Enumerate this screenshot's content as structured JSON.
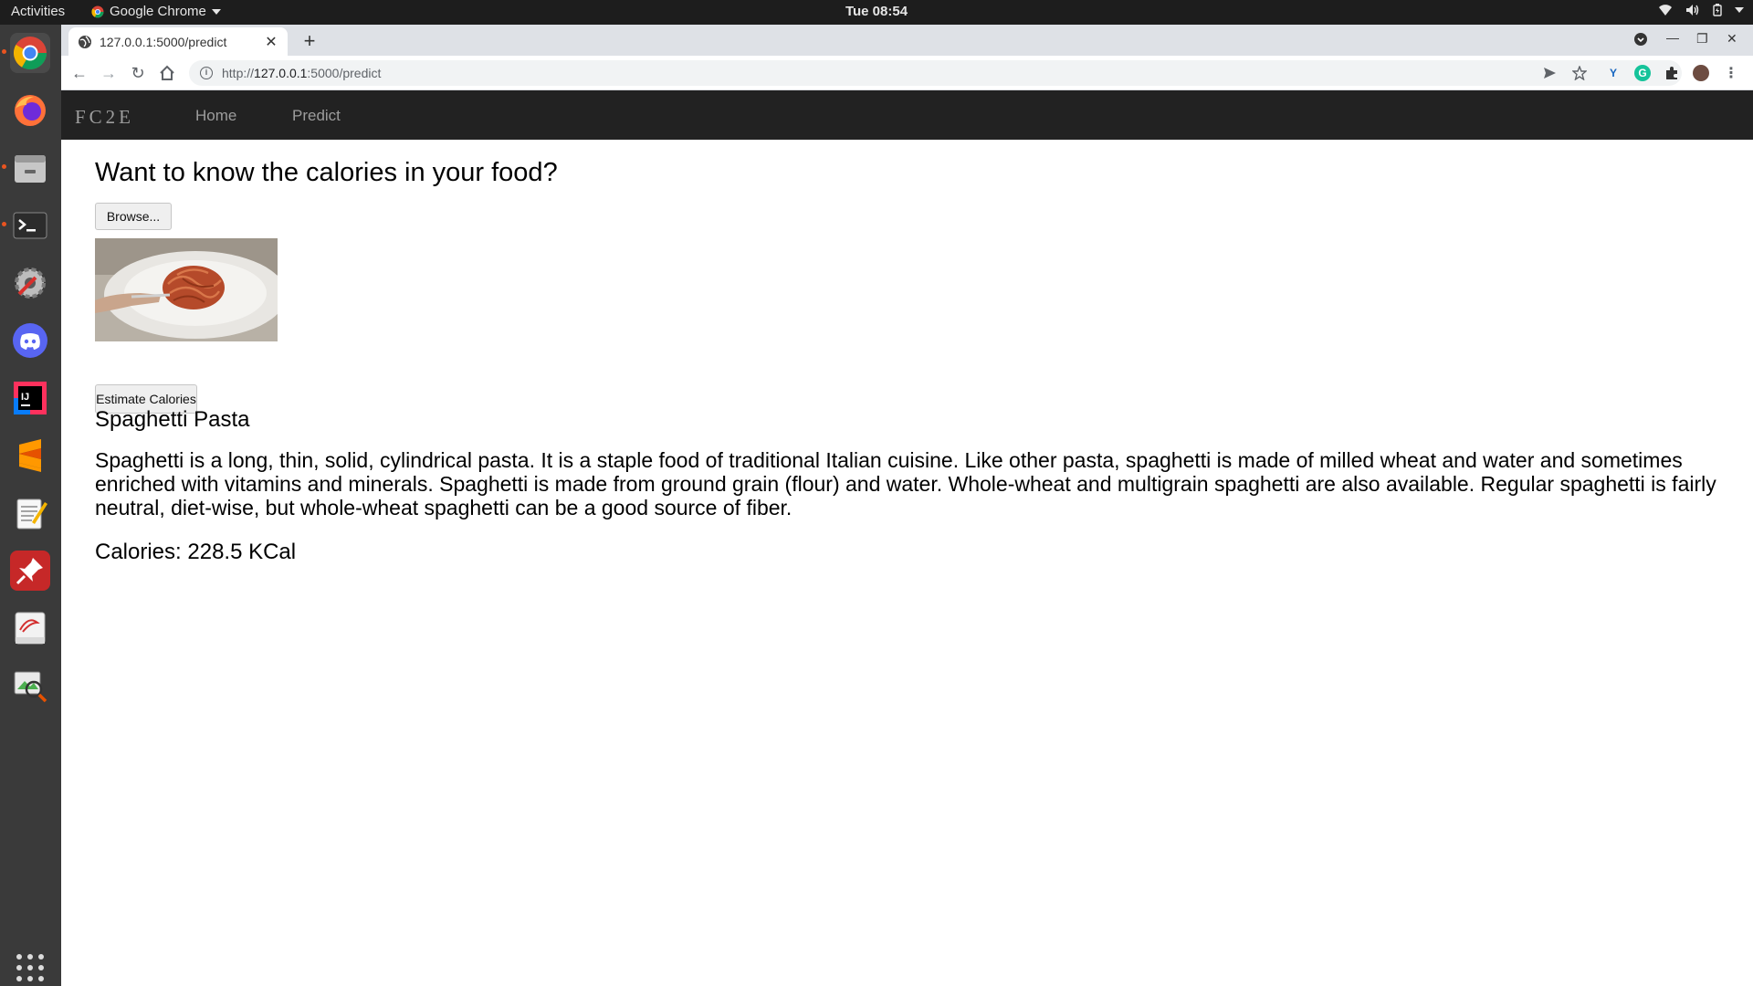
{
  "system": {
    "activities_label": "Activities",
    "app_name": "Google Chrome",
    "clock": "Tue 08:54"
  },
  "dock": {
    "apps": [
      "chrome-icon",
      "firefox-icon",
      "files-icon",
      "terminal-icon",
      "settings-icon",
      "discord-icon",
      "intellij-icon",
      "sublime-text-icon",
      "text-editor-icon",
      "pin-app-icon",
      "evince-icon",
      "image-viewer-icon"
    ]
  },
  "browser": {
    "tab_title": "127.0.0.1:5000/predict",
    "url_prefix": "http://",
    "url_host": "127.0.0.1",
    "url_rest": ":5000/predict"
  },
  "site": {
    "brand": "FC2E",
    "nav": [
      {
        "label": "Home"
      },
      {
        "label": "Predict"
      }
    ]
  },
  "main": {
    "heading": "Want to know the calories in your food?",
    "browse_label": "Browse...",
    "estimate_label": "Estimate Calories",
    "food_name": "Spaghetti Pasta",
    "description": "Spaghetti is a long, thin, solid, cylindrical pasta. It is a staple food of traditional Italian cuisine. Like other pasta, spaghetti is made of milled wheat and water and sometimes enriched with vitamins and minerals. Spaghetti is made from ground grain (flour) and water. Whole-wheat and multigrain spaghetti are also available. Regular spaghetti is fairly neutral, diet-wise, but whole-wheat spaghetti can be a good source of fiber.",
    "calories_text": "Calories: 228.5 KCal"
  },
  "colors": {
    "navbar_bg": "#222222",
    "navbar_text": "#9d9d9d",
    "dock_bg": "#3a3a3a",
    "topbar_bg": "#1d1d1d",
    "accent_dot": "#e95420"
  }
}
